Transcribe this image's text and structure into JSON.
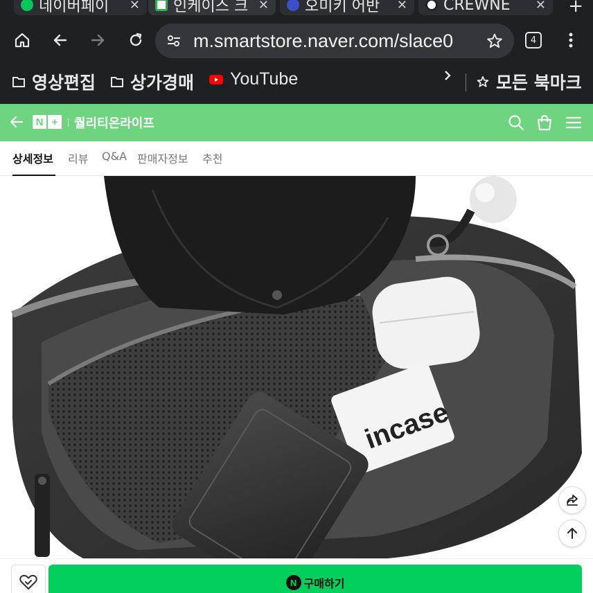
{
  "browser": {
    "tabs": [
      {
        "label": "네이버페이",
        "icon": "naver-pay-icon"
      },
      {
        "label": "인케이스 크",
        "icon": "store-favicon"
      },
      {
        "label": "오미키 어반",
        "icon": "page-favicon"
      },
      {
        "label": "CREWNE",
        "icon": "crewne-favicon"
      }
    ],
    "new_tab": "+",
    "url": "m.smartstore.naver.com/slace0",
    "tab_count": "4",
    "bookmarks": [
      {
        "label": "영상편집",
        "icon": "folder-icon"
      },
      {
        "label": "상가경매",
        "icon": "folder-icon"
      },
      {
        "label": "YouTube",
        "icon": "youtube-icon"
      }
    ],
    "all_bookmarks": "모든 북마크"
  },
  "store": {
    "name": "퀄리티온라이프",
    "logo": [
      "N",
      "+"
    ],
    "accent": "#6ed47f"
  },
  "subtabs": [
    {
      "label": "상세정보",
      "active": true
    },
    {
      "label": "리뷰"
    },
    {
      "label": "Q&A"
    },
    {
      "label": "판매자정보"
    },
    {
      "label": "추천"
    }
  ],
  "product_image": {
    "brand_text": "incase"
  },
  "bottom": {
    "buy_label": "구매하기",
    "buy_badge": "N",
    "buy_color": "#03cf5d"
  }
}
